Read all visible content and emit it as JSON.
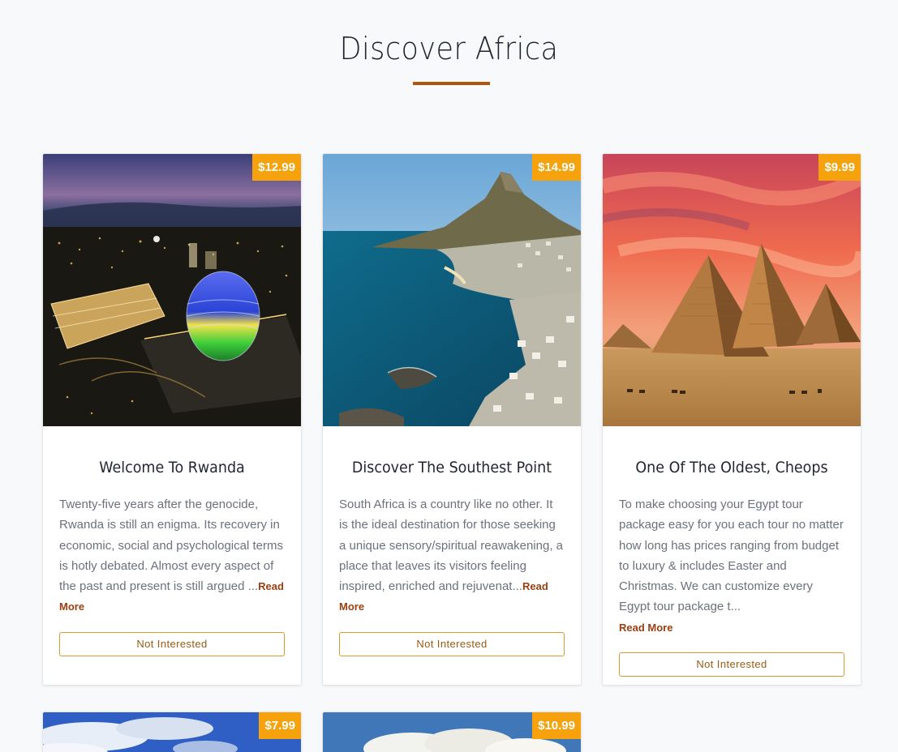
{
  "page": {
    "title": "Discover Africa",
    "accent_color": "#b3540d",
    "price_badge_color": "#f5a20d"
  },
  "cards": [
    {
      "price": "$12.99",
      "image": "rwanda-convention-center-night-photo",
      "title": "Welcome To Rwanda",
      "text": "Twenty-five years after the genocide, Rwanda is still an enigma. Its recovery in economic, social and psychological terms is hotly debated. Almost every aspect of the past and present is still argued ...",
      "read_more": "Read More",
      "button": "Not Interested"
    },
    {
      "price": "$14.99",
      "image": "cape-town-coast-lions-head-photo",
      "title": "Discover The Southest Point",
      "text": "South Africa is a country like no other. It is the ideal destination for those seeking a unique sensory/spiritual reawakening, a place that leaves its visitors feeling inspired, enriched and rejuvenat...",
      "read_more": "Read More",
      "button": "Not Interested"
    },
    {
      "price": "$9.99",
      "image": "giza-pyramids-sunset-photo",
      "title": "One Of The Oldest, Cheops",
      "text": "To make choosing your Egypt tour package easy for you each tour no matter how long has prices ranging from budget to luxury & includes Easter and Christmas. We can customize every Egypt tour package t...",
      "read_more": "Read More",
      "button": "Not Interested"
    },
    {
      "price": "$7.99",
      "image": "blue-sky-clouds-photo"
    },
    {
      "price": "$10.99",
      "image": "clouds-over-mountains-photo"
    }
  ]
}
